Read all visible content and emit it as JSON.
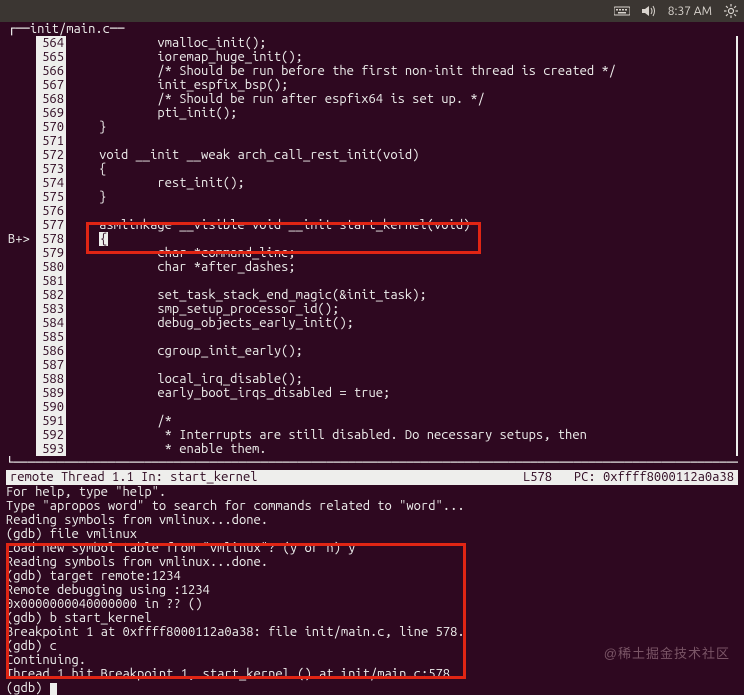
{
  "menubar": {
    "time": "8:37 AM",
    "keyboard_icon": "keyboard",
    "sound_icon": "sound",
    "gear_icon": "gear"
  },
  "title_line": "┌──init/main.c──",
  "bp_marker": "B+>",
  "source": [
    {
      "n": "564",
      "t": "            vmalloc_init();"
    },
    {
      "n": "565",
      "t": "            ioremap_huge_init();"
    },
    {
      "n": "566",
      "t": "            /* Should be run before the first non-init thread is created */"
    },
    {
      "n": "567",
      "t": "            init_espfix_bsp();"
    },
    {
      "n": "568",
      "t": "            /* Should be run after espfix64 is set up. */"
    },
    {
      "n": "569",
      "t": "            pti_init();"
    },
    {
      "n": "570",
      "t": "    }"
    },
    {
      "n": "571",
      "t": ""
    },
    {
      "n": "572",
      "t": "    void __init __weak arch_call_rest_init(void)"
    },
    {
      "n": "573",
      "t": "    {"
    },
    {
      "n": "574",
      "t": "            rest_init();"
    },
    {
      "n": "575",
      "t": "    }"
    },
    {
      "n": "576",
      "t": ""
    },
    {
      "n": "577",
      "t": "    asmlinkage __visible void __init start_kernel(void)"
    },
    {
      "n": "578",
      "t": "    {",
      "bp": true
    },
    {
      "n": "579",
      "t": "            char *command_line;"
    },
    {
      "n": "580",
      "t": "            char *after_dashes;"
    },
    {
      "n": "581",
      "t": ""
    },
    {
      "n": "582",
      "t": "            set_task_stack_end_magic(&init_task);"
    },
    {
      "n": "583",
      "t": "            smp_setup_processor_id();"
    },
    {
      "n": "584",
      "t": "            debug_objects_early_init();"
    },
    {
      "n": "585",
      "t": ""
    },
    {
      "n": "586",
      "t": "            cgroup_init_early();"
    },
    {
      "n": "587",
      "t": ""
    },
    {
      "n": "588",
      "t": "            local_irq_disable();"
    },
    {
      "n": "589",
      "t": "            early_boot_irqs_disabled = true;"
    },
    {
      "n": "590",
      "t": ""
    },
    {
      "n": "591",
      "t": "            /*"
    },
    {
      "n": "592",
      "t": "             * Interrupts are still disabled. Do necessary setups, then"
    },
    {
      "n": "593",
      "t": "             * enable them."
    }
  ],
  "dash_line": "└──────────────────────────────────────────────────────────────────────────────────────────────────────────────┘",
  "status": {
    "left": "remote Thread 1.1 In: start_kernel",
    "right": "L578   PC: 0xffff8000112a0a38"
  },
  "gdb": [
    "For help, type \"help\".",
    "Type \"apropos word\" to search for commands related to \"word\"...",
    "Reading symbols from vmlinux...done.",
    "(gdb) file vmlinux",
    "Load new symbol table from \"vmlinux\"? (y or n) y",
    "Reading symbols from vmlinux...done.",
    "(gdb) target remote:1234",
    "Remote debugging using :1234",
    "0x0000000040000000 in ?? ()",
    "(gdb) b start_kernel",
    "Breakpoint 1 at 0xffff8000112a0a38: file init/main.c, line 578.",
    "(gdb) c",
    "Continuing.",
    "",
    "Thread 1 hit Breakpoint 1, start_kernel () at init/main.c:578",
    "(gdb) "
  ],
  "watermark": "@稀土掘金技术社区"
}
